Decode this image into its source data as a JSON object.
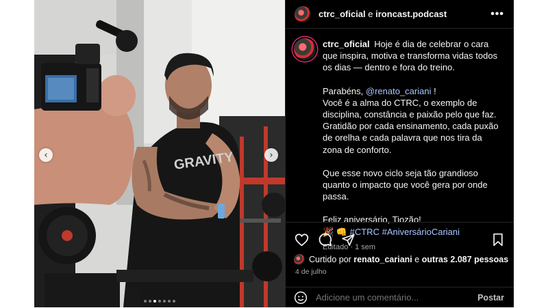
{
  "post": {
    "header": {
      "author": "ctrc_oficial",
      "separator": "e",
      "coauthor": "ironcast.podcast",
      "more_icon": "more-horizontal-icon"
    },
    "caption": {
      "username": "ctrc_oficial",
      "intro": "Hoje é dia de celebrar o cara que inspira, motiva e transforma vidas todos os dias — dentro e fora do treino.",
      "congrats_prefix": "Parabéns,",
      "mention": "@renato_cariani",
      "congrats_suffix": "!",
      "line_alma": "Você é a alma do CTRC, o exemplo de disciplina, constância e paixão pelo que faz.",
      "line_gratidao": "Gratidão por cada ensinamento, cada puxão de orelha e cada palavra que nos tira da zona de conforto.",
      "wish": "Que esse novo ciclo seja tão grandioso quanto o impacto que você gera por onde passa.",
      "closing": "Feliz aniversário, Tiozão!",
      "emojis": "🎉 👊",
      "hashtag1": "#CTRC",
      "hashtag2": "#AniversárioCariani",
      "meta": "Editado · 1 sem"
    },
    "actions": {
      "like_icon": "heart-icon",
      "comment_icon": "comment-icon",
      "share_icon": "send-icon",
      "save_icon": "bookmark-icon"
    },
    "likes": {
      "prefix": "Curtido por",
      "user": "renato_cariani",
      "joiner": "e",
      "others": "outras 2.087 pessoas"
    },
    "date": "4 de julho",
    "comment": {
      "placeholder": "Adicione um comentário...",
      "post_label": "Postar",
      "emoji_icon": "smiley-icon"
    },
    "carousel": {
      "prev_icon": "chevron-left-icon",
      "next_icon": "chevron-right-icon",
      "total_dots": 7,
      "active_dot": 3
    },
    "photo": {
      "shirt_text": "GRAVITY"
    }
  }
}
